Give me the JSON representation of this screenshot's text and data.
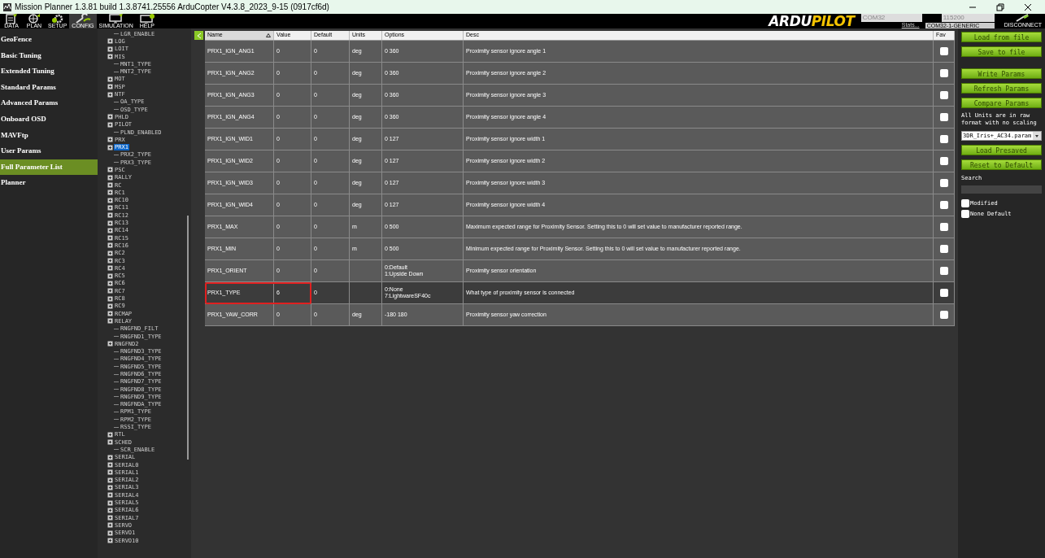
{
  "window": {
    "title": "Mission Planner 1.3.81 build 1.3.8741.25556 ArduCopter V4.3.8_2023_9-15 (0917cf6d)"
  },
  "toolbar": [
    {
      "label": "DATA",
      "kind": "data",
      "selected": false
    },
    {
      "label": "PLAN",
      "kind": "plan",
      "selected": false
    },
    {
      "label": "SETUP",
      "kind": "setup",
      "selected": false
    },
    {
      "label": "CONFIG",
      "kind": "config",
      "selected": true
    },
    {
      "label": "SIMULATION",
      "kind": "simulation",
      "selected": false
    },
    {
      "label": "HELP",
      "kind": "help",
      "selected": false
    }
  ],
  "connection": {
    "logo": [
      "ARDU",
      "PILOT"
    ],
    "port": "COM32",
    "baud": "115200",
    "stats": "Stats...",
    "device": "COM32-1-GENERIC",
    "disconnect": "DISCONNECT"
  },
  "menu": [
    {
      "label": "GeoFence",
      "selected": false
    },
    {
      "label": "Basic Tuning",
      "selected": false
    },
    {
      "label": "Extended Tuning",
      "selected": false
    },
    {
      "label": "Standard Params",
      "selected": false
    },
    {
      "label": "Advanced Params",
      "selected": false
    },
    {
      "label": "Onboard OSD",
      "selected": false
    },
    {
      "label": "MAVFtp",
      "selected": false
    },
    {
      "label": "User Params",
      "selected": false
    },
    {
      "label": "Full Parameter List",
      "selected": true
    },
    {
      "label": "Planner",
      "selected": false
    }
  ],
  "tree": [
    {
      "label": "LGR_ENABLE",
      "kind": "leaf",
      "selected": false
    },
    {
      "label": "LOG",
      "kind": "group",
      "selected": false
    },
    {
      "label": "LOIT",
      "kind": "group",
      "selected": false
    },
    {
      "label": "MIS",
      "kind": "group",
      "selected": false
    },
    {
      "label": "MNT1_TYPE",
      "kind": "leaf",
      "selected": false
    },
    {
      "label": "MNT2_TYPE",
      "kind": "leaf",
      "selected": false
    },
    {
      "label": "MOT",
      "kind": "group",
      "selected": false
    },
    {
      "label": "MSP",
      "kind": "group",
      "selected": false
    },
    {
      "label": "NTF",
      "kind": "group",
      "selected": false
    },
    {
      "label": "OA_TYPE",
      "kind": "leaf",
      "selected": false
    },
    {
      "label": "OSD_TYPE",
      "kind": "leaf",
      "selected": false
    },
    {
      "label": "PHLD",
      "kind": "group",
      "selected": false
    },
    {
      "label": "PILOT",
      "kind": "group",
      "selected": false
    },
    {
      "label": "PLND_ENABLED",
      "kind": "leaf",
      "selected": false
    },
    {
      "label": "PRX",
      "kind": "group",
      "selected": false
    },
    {
      "label": "PRX1",
      "kind": "group",
      "selected": true
    },
    {
      "label": "PRX2_TYPE",
      "kind": "leaf",
      "selected": false
    },
    {
      "label": "PRX3_TYPE",
      "kind": "leaf",
      "selected": false
    },
    {
      "label": "PSC",
      "kind": "group",
      "selected": false
    },
    {
      "label": "RALLY",
      "kind": "group",
      "selected": false
    },
    {
      "label": "RC",
      "kind": "group",
      "selected": false
    },
    {
      "label": "RC1",
      "kind": "group",
      "selected": false
    },
    {
      "label": "RC10",
      "kind": "group",
      "selected": false
    },
    {
      "label": "RC11",
      "kind": "group",
      "selected": false
    },
    {
      "label": "RC12",
      "kind": "group",
      "selected": false
    },
    {
      "label": "RC13",
      "kind": "group",
      "selected": false
    },
    {
      "label": "RC14",
      "kind": "group",
      "selected": false
    },
    {
      "label": "RC15",
      "kind": "group",
      "selected": false
    },
    {
      "label": "RC16",
      "kind": "group",
      "selected": false
    },
    {
      "label": "RC2",
      "kind": "group",
      "selected": false
    },
    {
      "label": "RC3",
      "kind": "group",
      "selected": false
    },
    {
      "label": "RC4",
      "kind": "group",
      "selected": false
    },
    {
      "label": "RC5",
      "kind": "group",
      "selected": false
    },
    {
      "label": "RC6",
      "kind": "group",
      "selected": false
    },
    {
      "label": "RC7",
      "kind": "group",
      "selected": false
    },
    {
      "label": "RC8",
      "kind": "group",
      "selected": false
    },
    {
      "label": "RC9",
      "kind": "group",
      "selected": false
    },
    {
      "label": "RCMAP",
      "kind": "group",
      "selected": false
    },
    {
      "label": "RELAY",
      "kind": "group",
      "selected": false
    },
    {
      "label": "RNGFND_FILT",
      "kind": "leaf",
      "selected": false
    },
    {
      "label": "RNGFND1_TYPE",
      "kind": "leaf",
      "selected": false
    },
    {
      "label": "RNGFND2",
      "kind": "group",
      "selected": false
    },
    {
      "label": "RNGFND3_TYPE",
      "kind": "leaf",
      "selected": false
    },
    {
      "label": "RNGFND4_TYPE",
      "kind": "leaf",
      "selected": false
    },
    {
      "label": "RNGFND5_TYPE",
      "kind": "leaf",
      "selected": false
    },
    {
      "label": "RNGFND6_TYPE",
      "kind": "leaf",
      "selected": false
    },
    {
      "label": "RNGFND7_TYPE",
      "kind": "leaf",
      "selected": false
    },
    {
      "label": "RNGFND8_TYPE",
      "kind": "leaf",
      "selected": false
    },
    {
      "label": "RNGFND9_TYPE",
      "kind": "leaf",
      "selected": false
    },
    {
      "label": "RNGFNDA_TYPE",
      "kind": "leaf",
      "selected": false
    },
    {
      "label": "RPM1_TYPE",
      "kind": "leaf",
      "selected": false
    },
    {
      "label": "RPM2_TYPE",
      "kind": "leaf",
      "selected": false
    },
    {
      "label": "RSSI_TYPE",
      "kind": "leaf",
      "selected": false
    },
    {
      "label": "RTL",
      "kind": "group",
      "selected": false
    },
    {
      "label": "SCHED",
      "kind": "group",
      "selected": false
    },
    {
      "label": "SCR_ENABLE",
      "kind": "leaf",
      "selected": false
    },
    {
      "label": "SERIAL",
      "kind": "group",
      "selected": false
    },
    {
      "label": "SERIAL0",
      "kind": "group",
      "selected": false
    },
    {
      "label": "SERIAL1",
      "kind": "group",
      "selected": false
    },
    {
      "label": "SERIAL2",
      "kind": "group",
      "selected": false
    },
    {
      "label": "SERIAL3",
      "kind": "group",
      "selected": false
    },
    {
      "label": "SERIAL4",
      "kind": "group",
      "selected": false
    },
    {
      "label": "SERIAL5",
      "kind": "group",
      "selected": false
    },
    {
      "label": "SERIAL6",
      "kind": "group",
      "selected": false
    },
    {
      "label": "SERIAL7",
      "kind": "group",
      "selected": false
    },
    {
      "label": "SERVO",
      "kind": "group",
      "selected": false
    },
    {
      "label": "SERVO1",
      "kind": "group",
      "selected": false
    },
    {
      "label": "SERVO10",
      "kind": "group",
      "selected": false
    }
  ],
  "table": {
    "columns": [
      {
        "label": "Name",
        "sorted": true
      },
      {
        "label": "Value",
        "sorted": false
      },
      {
        "label": "Default",
        "sorted": false
      },
      {
        "label": "Units",
        "sorted": false
      },
      {
        "label": "Options",
        "sorted": false
      },
      {
        "label": "Desc",
        "sorted": false
      },
      {
        "label": "Fav",
        "sorted": false
      }
    ],
    "rows": [
      {
        "name": "PRX1_IGN_ANG1",
        "value": "0",
        "default": "0",
        "units": "deg",
        "options": [
          "0 360"
        ],
        "desc": "Proximity sensor ignore angle 1",
        "selected": false,
        "highlighted": false,
        "fav": false
      },
      {
        "name": "PRX1_IGN_ANG2",
        "value": "0",
        "default": "0",
        "units": "deg",
        "options": [
          "0 360"
        ],
        "desc": "Proximity sensor ignore angle 2",
        "selected": false,
        "highlighted": false,
        "fav": false
      },
      {
        "name": "PRX1_IGN_ANG3",
        "value": "0",
        "default": "0",
        "units": "deg",
        "options": [
          "0 360"
        ],
        "desc": "Proximity sensor ignore angle 3",
        "selected": false,
        "highlighted": false,
        "fav": false
      },
      {
        "name": "PRX1_IGN_ANG4",
        "value": "0",
        "default": "0",
        "units": "deg",
        "options": [
          "0 360"
        ],
        "desc": "Proximity sensor ignore angle 4",
        "selected": false,
        "highlighted": false,
        "fav": false
      },
      {
        "name": "PRX1_IGN_WID1",
        "value": "0",
        "default": "0",
        "units": "deg",
        "options": [
          "0 127"
        ],
        "desc": "Proximity sensor ignore width 1",
        "selected": false,
        "highlighted": false,
        "fav": false
      },
      {
        "name": "PRX1_IGN_WID2",
        "value": "0",
        "default": "0",
        "units": "deg",
        "options": [
          "0 127"
        ],
        "desc": "Proximity sensor ignore width 2",
        "selected": false,
        "highlighted": false,
        "fav": false
      },
      {
        "name": "PRX1_IGN_WID3",
        "value": "0",
        "default": "0",
        "units": "deg",
        "options": [
          "0 127"
        ],
        "desc": "Proximity sensor ignore width 3",
        "selected": false,
        "highlighted": false,
        "fav": false
      },
      {
        "name": "PRX1_IGN_WID4",
        "value": "0",
        "default": "0",
        "units": "deg",
        "options": [
          "0 127"
        ],
        "desc": "Proximity sensor ignore width 4",
        "selected": false,
        "highlighted": false,
        "fav": false
      },
      {
        "name": "PRX1_MAX",
        "value": "0",
        "default": "0",
        "units": "m",
        "options": [
          "0 500"
        ],
        "desc": "Maximum expected range for Proximity Sensor. Setting this to 0 will set value to manufacturer reported range.",
        "selected": false,
        "highlighted": false,
        "fav": false
      },
      {
        "name": "PRX1_MIN",
        "value": "0",
        "default": "0",
        "units": "m",
        "options": [
          "0 500"
        ],
        "desc": "Minimum expected range for Proximity Sensor. Setting this to 0 will set value to manufacturer reported range.",
        "selected": false,
        "highlighted": false,
        "fav": false
      },
      {
        "name": "PRX1_ORIENT",
        "value": "0",
        "default": "0",
        "units": "",
        "options": [
          "0:Default",
          "1:Upside Down"
        ],
        "desc": "Proximity sensor orientation",
        "selected": false,
        "highlighted": false,
        "fav": false
      },
      {
        "name": "PRX1_TYPE",
        "value": "6",
        "default": "0",
        "units": "",
        "options": [
          "0:None",
          "7:LightwareSF40c"
        ],
        "desc": "What type of proximity sensor is connected",
        "selected": true,
        "highlighted": true,
        "fav": false
      },
      {
        "name": "PRX1_YAW_CORR",
        "value": "0",
        "default": "0",
        "units": "deg",
        "options": [
          "-180 180"
        ],
        "desc": "Proximity sensor yaw correction",
        "selected": false,
        "highlighted": false,
        "fav": false
      }
    ]
  },
  "side": {
    "buttons_top": [
      "Load from file",
      "Save to file"
    ],
    "buttons_mid": [
      "Write Params",
      "Refresh Params",
      "Compare Params"
    ],
    "note": "All Units are in raw format with no scaling",
    "param_file": "3DR_Iris+_AC34.param",
    "buttons_bottom": [
      "Load Presaved",
      "Reset to Default"
    ],
    "search_label": "Search",
    "filters": [
      {
        "label": "Modified",
        "checked": false
      },
      {
        "label": "None Default",
        "checked": false
      }
    ]
  }
}
